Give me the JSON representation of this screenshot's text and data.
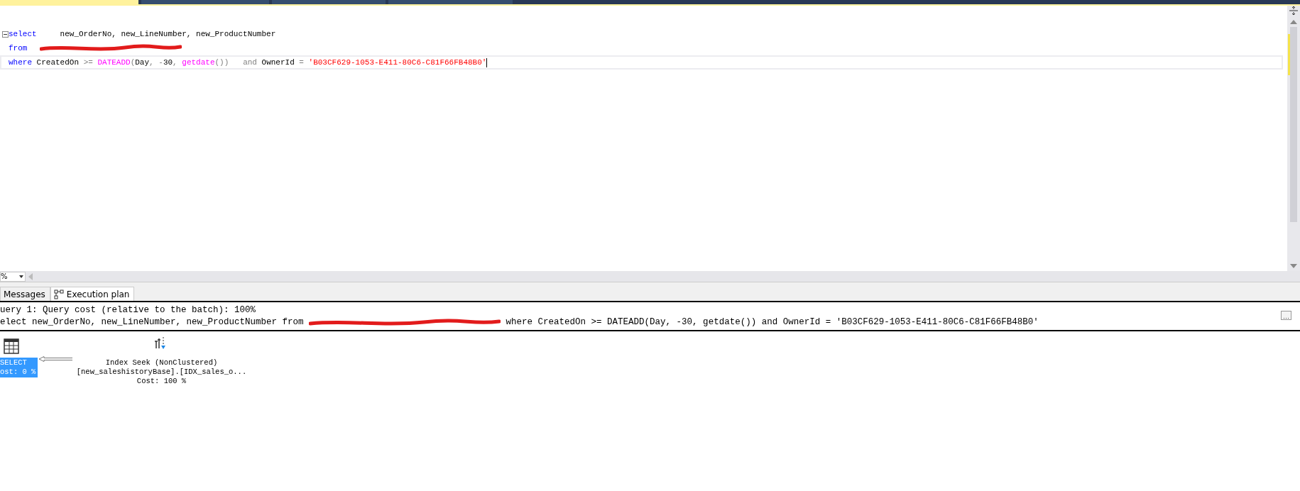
{
  "document_tabs": [
    {
      "selected": true
    },
    {
      "selected": false
    },
    {
      "selected": false
    },
    {
      "selected": false
    }
  ],
  "editor": {
    "lines": [
      {
        "collapsible": true,
        "current": false,
        "tokens": [
          {
            "kind": "keyword",
            "text": "select"
          },
          {
            "kind": "plain",
            "text": "     new_OrderNo, new_LineNumber, new_ProductNumber"
          }
        ]
      },
      {
        "collapsible": false,
        "current": false,
        "tokens": [
          {
            "kind": "keyword",
            "text": "from"
          },
          {
            "kind": "redaction"
          }
        ]
      },
      {
        "collapsible": false,
        "current": true,
        "tokens": [
          {
            "kind": "keyword",
            "text": "where"
          },
          {
            "kind": "plain",
            "text": " CreatedOn "
          },
          {
            "kind": "operator",
            "text": ">="
          },
          {
            "kind": "function",
            "text": " DATEADD"
          },
          {
            "kind": "operator",
            "text": "("
          },
          {
            "kind": "plain",
            "text": "Day"
          },
          {
            "kind": "operator",
            "text": ","
          },
          {
            "kind": "operator",
            "text": " -"
          },
          {
            "kind": "plain",
            "text": "30"
          },
          {
            "kind": "operator",
            "text": ","
          },
          {
            "kind": "function",
            "text": " getdate"
          },
          {
            "kind": "operator",
            "text": "())"
          },
          {
            "kind": "operator",
            "text": "   and"
          },
          {
            "kind": "plain",
            "text": " OwnerId "
          },
          {
            "kind": "operator",
            "text": "="
          },
          {
            "kind": "string",
            "text": " 'B03CF629-1053-E411-80C6-C81F66FB48B0'"
          }
        ]
      }
    ]
  },
  "zoom": {
    "value": "%"
  },
  "result_tabs": [
    {
      "label": "Messages",
      "selected": false
    },
    {
      "label": "Execution plan",
      "selected": true
    }
  ],
  "plan": {
    "header": "uery 1: Query cost (relative to the batch): 100%",
    "statement": [
      {
        "kind": "text",
        "text": "elect new_OrderNo, new_LineNumber, new_ProductNumber from "
      },
      {
        "kind": "redaction"
      },
      {
        "kind": "text",
        "text": " where CreatedOn >= DATEADD(Day, -30, getdate()) and OwnerId = 'B03CF629-1053-E411-80C6-C81F66FB48B0'"
      }
    ],
    "nodes": [
      {
        "kind": "select",
        "selected": true,
        "lines": [
          "SELECT",
          "ost: 0 %"
        ]
      },
      {
        "kind": "index_seek",
        "selected": false,
        "lines": [
          "Index Seek (NonClustered)",
          "[new_saleshistoryBase].[IDX_sales_o...",
          "Cost: 100 %"
        ]
      }
    ]
  }
}
